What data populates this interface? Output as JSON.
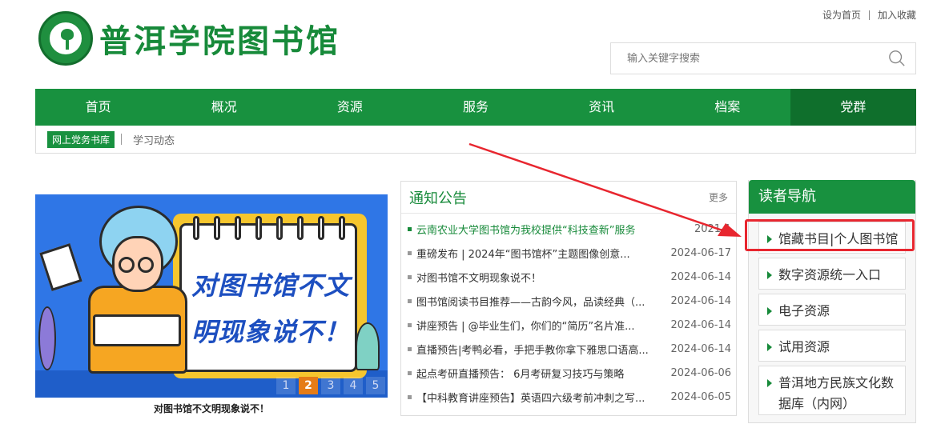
{
  "header": {
    "site_title": "普洱学院图书馆",
    "logo_alt": "普洱学院校徽",
    "top_links": [
      "设为首页",
      "加入收藏"
    ]
  },
  "search": {
    "placeholder": "输入关键字搜索",
    "icon": "search-icon"
  },
  "nav": {
    "items": [
      "首页",
      "概况",
      "资源",
      "服务",
      "资讯",
      "档案",
      "党群"
    ],
    "active_index": 6
  },
  "subnav": {
    "current": "网上党务书库",
    "other": "学习动态"
  },
  "banner": {
    "text_line1": "对图书馆不文",
    "text_line2": "明现象说不！",
    "caption": "对图书馆不文明现象说不！",
    "pages": [
      "1",
      "2",
      "3",
      "4",
      "5"
    ],
    "active_page": 2
  },
  "notices": {
    "title": "通知公告",
    "more": "更多",
    "items": [
      {
        "title": "云南农业大学图书馆为我校提供“科技查新”服务",
        "date": "2021-1",
        "highlight": true
      },
      {
        "title": "重磅发布 | 2024年“图书馆杯”主题图像创意...",
        "date": "2024-06-17"
      },
      {
        "title": "对图书馆不文明现象说不！",
        "date": "2024-06-14"
      },
      {
        "title": "图书馆阅读书目推荐——古韵今风，品读经典（...",
        "date": "2024-06-14"
      },
      {
        "title": "讲座预告 | @毕业生们，你们的“简历”名片准...",
        "date": "2024-06-14"
      },
      {
        "title": "直播预告|考鸭必看，手把手教你拿下雅思口语高...",
        "date": "2024-06-14"
      },
      {
        "title": "起点考研直播预告： 6月考研复习技巧与策略",
        "date": "2024-06-06"
      },
      {
        "title": "【中科教育讲座预告】英语四六级考前冲刺之写...",
        "date": "2024-06-05"
      }
    ]
  },
  "reader_nav": {
    "title": "读者导航",
    "items": [
      "馆藏书目|个人图书馆",
      "数字资源统一入口",
      "电子资源",
      "试用资源",
      "普洱地方民族文化数据库（内网）"
    ]
  },
  "colors": {
    "brand_green": "#18913f",
    "dark_green": "#0f6f2c",
    "callout_red": "#e8262f",
    "banner_blue": "#2f76e6"
  }
}
